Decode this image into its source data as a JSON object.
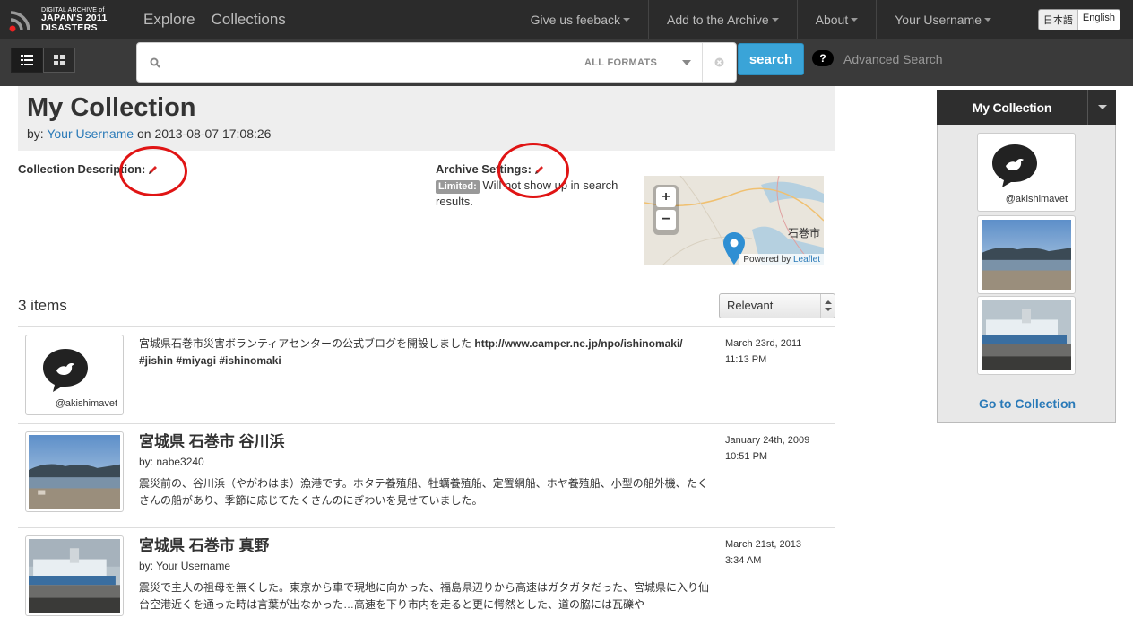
{
  "header": {
    "logo_top": "DIGITAL ARCHIVE of",
    "logo_mid": "JAPAN'S 2011",
    "logo_bottom": "DISASTERS",
    "nav": [
      "Explore",
      "Collections"
    ],
    "right_nav": [
      "Give us feeback",
      "Add to the Archive",
      "About",
      "Your Username"
    ],
    "lang": [
      "日本語",
      "English"
    ]
  },
  "search": {
    "placeholder": "",
    "format": "ALL FORMATS",
    "button": "search",
    "help": "?",
    "advanced": "Advanced Search"
  },
  "collection": {
    "title": "My Collection",
    "by_prefix": "by:",
    "author": "Your Username",
    "on_text": "on 2013-08-07 17:08:26",
    "description_label": "Collection Description:",
    "archive_label": "Archive Settings:",
    "limited": "Limited:",
    "archive_note": " Will not show up in search results."
  },
  "map": {
    "zoom_in": "+",
    "zoom_out": "−",
    "city": "石巻市",
    "powered_by": "Powered by ",
    "leaflet": "Leaflet"
  },
  "list": {
    "count": "3 items",
    "sort": "Relevant",
    "items": [
      {
        "type": "tweet",
        "handle": "@akishimavet",
        "text": "宮城県石巻市災害ボランティアセンターの公式ブログを開設しました ",
        "bold_text": "http://www.camper.ne.jp/npo/ishinomaki/ #jishin #miyagi #ishinomaki",
        "date": "March 23rd, 2011",
        "time": "11:13 PM"
      },
      {
        "type": "photo",
        "title": "宮城県 石巻市 谷川浜",
        "by": "by: nabe3240",
        "text": "震災前の、谷川浜（やがわはま）漁港です。ホタテ養殖船、牡蠣養殖船、定置網船、ホヤ養殖船、小型の船外機、たくさんの船があり、季節に応じてたくさんのにぎわいを見せていました。",
        "date": "January 24th, 2009",
        "time": "10:51 PM"
      },
      {
        "type": "photo",
        "title": "宮城県 石巻市 真野",
        "by": "by: Your Username",
        "text": "震災で主人の祖母を無くした。東京から車で現地に向かった、福島県辺りから高速はガタガタだった、宮城県に入り仙台空港近くを通った時は言葉が出なかった…高速を下り市内を走ると更に愕然とした、道の脇には瓦礫や",
        "date": "March 21st, 2013",
        "time": "3:34 AM"
      }
    ]
  },
  "sidebar": {
    "title": "My Collection",
    "handle": "@akishimavet",
    "go_link": "Go to Collection"
  },
  "colors": {
    "accent": "#3aa4d8",
    "link": "#2a7ab8",
    "annotation": "#e01414"
  }
}
